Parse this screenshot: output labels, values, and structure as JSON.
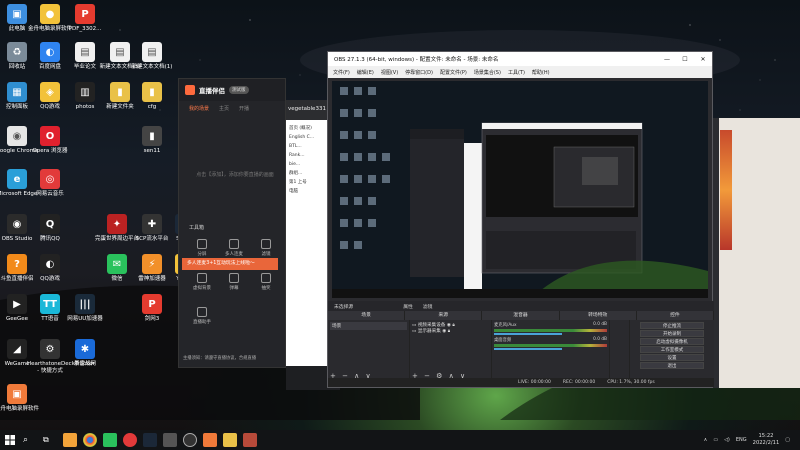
{
  "desktop_icons": [
    {
      "label": "此电脑",
      "color": "#3d8fe0",
      "glyph": "▣"
    },
    {
      "label": "金舟电脑录屏软件",
      "color": "#f2c23a",
      "glyph": "●"
    },
    {
      "label": "PDF_3302...",
      "color": "#e53b2f",
      "glyph": "P"
    },
    {
      "label": "回收站",
      "color": "#7b8b99",
      "glyph": "♻"
    },
    {
      "label": "百度网盘",
      "color": "#2f84f0",
      "glyph": "◐"
    },
    {
      "label": "毕业论文",
      "color": "#f0f0f0",
      "glyph": "▤"
    },
    {
      "label": "新建文本文档(3)",
      "color": "#f0f0f0",
      "glyph": "▤"
    },
    {
      "label": "新建文本文档(1)",
      "color": "#f0f0f0",
      "glyph": "▤"
    },
    {
      "label": "控制面板",
      "color": "#2f8ed0",
      "glyph": "▦"
    },
    {
      "label": "QQ游戏",
      "color": "#f2c23a",
      "glyph": "◈"
    },
    {
      "label": "photos",
      "color": "#222",
      "glyph": "▥"
    },
    {
      "label": "新建文件夹",
      "color": "#e9c148",
      "glyph": "▮"
    },
    {
      "label": "cfg",
      "color": "#e9c148",
      "glyph": "▮"
    },
    {
      "label": "Google Chrome",
      "color": "#e6e6e6",
      "glyph": "◉"
    },
    {
      "label": "Opera 浏览器",
      "color": "#e0212e",
      "glyph": "O"
    },
    {
      "label": "sen11",
      "color": "#444",
      "glyph": "▮"
    },
    {
      "label": "Microsoft Edge",
      "color": "#2a9fd8",
      "glyph": "e"
    },
    {
      "label": "网易云音乐",
      "color": "#e23a3a",
      "glyph": "◎"
    },
    {
      "label": "OBS Studio",
      "color": "#2b2b2b",
      "glyph": "◉"
    },
    {
      "label": "腾讯QQ",
      "color": "#222",
      "glyph": "Q"
    },
    {
      "label": "完蛋世界周边平台",
      "color": "#b22",
      "glyph": "✦"
    },
    {
      "label": "SCP流水平台",
      "color": "#333",
      "glyph": "✚"
    },
    {
      "label": "Stea...",
      "color": "#1b2838",
      "glyph": "S"
    },
    {
      "label": "斗鱼直播伴侣",
      "color": "#f28a1a",
      "glyph": "?"
    },
    {
      "label": "QQ游戏",
      "color": "#222",
      "glyph": "◐"
    },
    {
      "label": "微信",
      "color": "#2ac25d",
      "glyph": "✉"
    },
    {
      "label": "雷神加速器",
      "color": "#f2902a",
      "glyph": "⚡"
    },
    {
      "label": "YY语...",
      "color": "#f2c23a",
      "glyph": "Y"
    },
    {
      "label": "GeeGee",
      "color": "#222",
      "glyph": "▶"
    },
    {
      "label": "TT语音",
      "color": "#1ab8d8",
      "glyph": "TT"
    },
    {
      "label": "网易UU加速器",
      "color": "#1a2a3a",
      "glyph": "|||"
    },
    {
      "label": "剑网3",
      "color": "#e53b2f",
      "glyph": "P"
    },
    {
      "label": "WeGame",
      "color": "#222",
      "glyph": "◢"
    },
    {
      "label": "HearthstoneDeckTracker - 快捷方式",
      "color": "#333",
      "glyph": "⚙"
    },
    {
      "label": "暴雪战网",
      "color": "#1a6ad8",
      "glyph": "✱"
    },
    {
      "label": "金舟电脑录屏软件",
      "color": "#f07a3a",
      "glyph": "▣"
    }
  ],
  "live_app": {
    "title": "直播伴侣",
    "badge": "测试版",
    "tabs": [
      "我的场景",
      "主页",
      "开播"
    ],
    "hint": "点击【添加】，添加你要直播的画面",
    "tools_label": "工具箱",
    "banner": "多人连麦3+1互动玩法上线啦～",
    "tools": [
      "分屏",
      "多人连麦",
      "滤镜",
      "虚拟背景",
      "弹幕",
      "抽奖",
      "直播助手",
      "",
      ""
    ],
    "footer": "主播须知：请遵守直播协议，合规直播"
  },
  "mid_window": {
    "top_text": "vegetable331",
    "tree": [
      "首页 (概况)",
      "English C...",
      "BTL...",
      "Rank...",
      "bie...",
      "群组...",
      "第1 上号",
      "电脑"
    ]
  },
  "obs": {
    "title": "OBS 27.1.3 (64-bit, windows) - 配置文件: 未命名 - 场景: 未命名",
    "menu": [
      "文件(F)",
      "编辑(E)",
      "视图(V)",
      "停靠窗口(D)",
      "配置文件(P)",
      "场景集合(S)",
      "工具(T)",
      "帮助(H)"
    ],
    "scene_strip": [
      "未选择源",
      "属性",
      "滤镜"
    ],
    "dock_titles": [
      "场景",
      "来源",
      "混音器",
      "转场特效",
      "控件"
    ],
    "scenes": [
      "场景"
    ],
    "sources": [
      "视频采集设备",
      "显示器采集"
    ],
    "mixer": [
      {
        "name": "麦克风/Aux",
        "level": "0.0 dB"
      },
      {
        "name": "桌面音频",
        "level": "0.0 dB"
      }
    ],
    "controls": [
      "停止推流",
      "开始录制",
      "启动虚拟摄像机",
      "工作室模式",
      "设置",
      "退出"
    ],
    "status": [
      "LIVE: 00:00:00",
      "REC: 00:00:00",
      "CPU: 1.7%, 30.00 fps"
    ]
  },
  "taskbar": {
    "lang": "ENG",
    "time": "15:22",
    "date": "2022/2/11"
  }
}
